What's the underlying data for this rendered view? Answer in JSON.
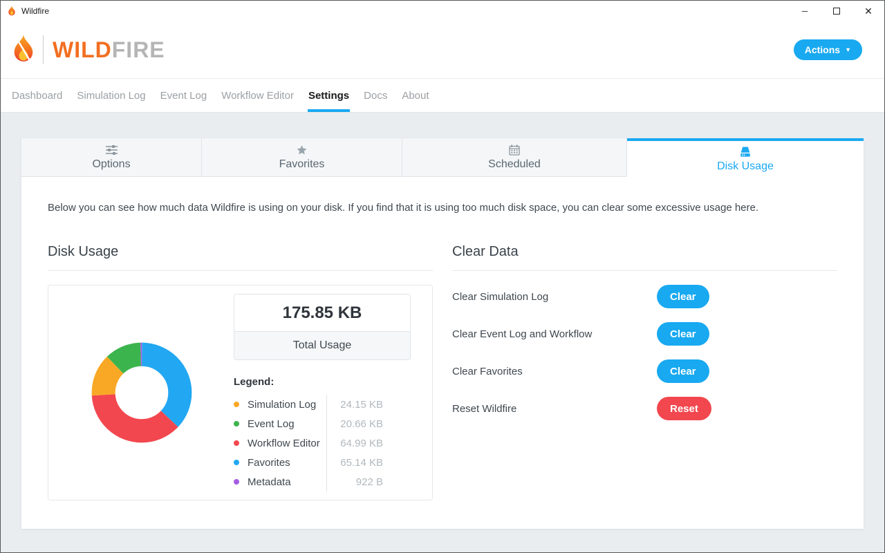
{
  "window": {
    "title": "Wildfire",
    "controls": {
      "minimize": "─",
      "close": "✕"
    }
  },
  "header": {
    "logo": {
      "primary": "WILD",
      "secondary": "FIRE"
    },
    "actions_button": "Actions"
  },
  "nav": {
    "items": [
      {
        "label": "Dashboard",
        "active": false
      },
      {
        "label": "Simulation Log",
        "active": false
      },
      {
        "label": "Event Log",
        "active": false
      },
      {
        "label": "Workflow Editor",
        "active": false
      },
      {
        "label": "Settings",
        "active": true
      },
      {
        "label": "Docs",
        "active": false
      },
      {
        "label": "About",
        "active": false
      }
    ]
  },
  "tabs": [
    {
      "label": "Options",
      "icon": "sliders-icon",
      "active": false
    },
    {
      "label": "Favorites",
      "icon": "star-icon",
      "active": false
    },
    {
      "label": "Scheduled",
      "icon": "calendar-icon",
      "active": false
    },
    {
      "label": "Disk Usage",
      "icon": "disk-icon",
      "active": true
    }
  ],
  "description": "Below you can see how much data Wildfire is using on your disk. If you find that it is using too much disk space, you can clear some excessive usage here.",
  "disk_usage_section": {
    "heading": "Disk Usage",
    "legend_heading": "Legend:"
  },
  "clear_data_section": {
    "heading": "Clear Data",
    "rows": [
      {
        "label": "Clear Simulation Log",
        "button": "Clear",
        "style": "accent"
      },
      {
        "label": "Clear Event Log and Workflow",
        "button": "Clear",
        "style": "accent"
      },
      {
        "label": "Clear Favorites",
        "button": "Clear",
        "style": "accent"
      },
      {
        "label": "Reset Wildfire",
        "button": "Reset",
        "style": "danger"
      }
    ]
  },
  "chart_data": {
    "type": "pie",
    "subtype": "donut",
    "title": "Disk Usage",
    "total_display": "175.85 KB",
    "total_label": "Total Usage",
    "unit": "KB",
    "legend_position": "right",
    "segments": [
      {
        "label": "Simulation Log",
        "display": "24.15 KB",
        "kb": 24.15,
        "color": "#f9a825"
      },
      {
        "label": "Event Log",
        "display": "20.66 KB",
        "kb": 20.66,
        "color": "#3cb44e"
      },
      {
        "label": "Workflow Editor",
        "display": "64.99 KB",
        "kb": 64.99,
        "color": "#f2474f"
      },
      {
        "label": "Favorites",
        "display": "65.14 KB",
        "kb": 65.14,
        "color": "#22a7f2"
      },
      {
        "label": "Metadata",
        "display": "922 B",
        "kb": 0.9,
        "color": "#a55de2"
      }
    ],
    "draw_order_clockwise_from_top": [
      "Favorites",
      "Workflow Editor",
      "Simulation Log",
      "Event Log",
      "Metadata"
    ]
  },
  "colors": {
    "accent": "#18a9f1",
    "danger": "#f2474f",
    "active_tab_bar": "#19a9f2",
    "logo_orange": "#f26f21",
    "logo_gray": "#b5b5b5",
    "page_background": "#e9edf0"
  }
}
